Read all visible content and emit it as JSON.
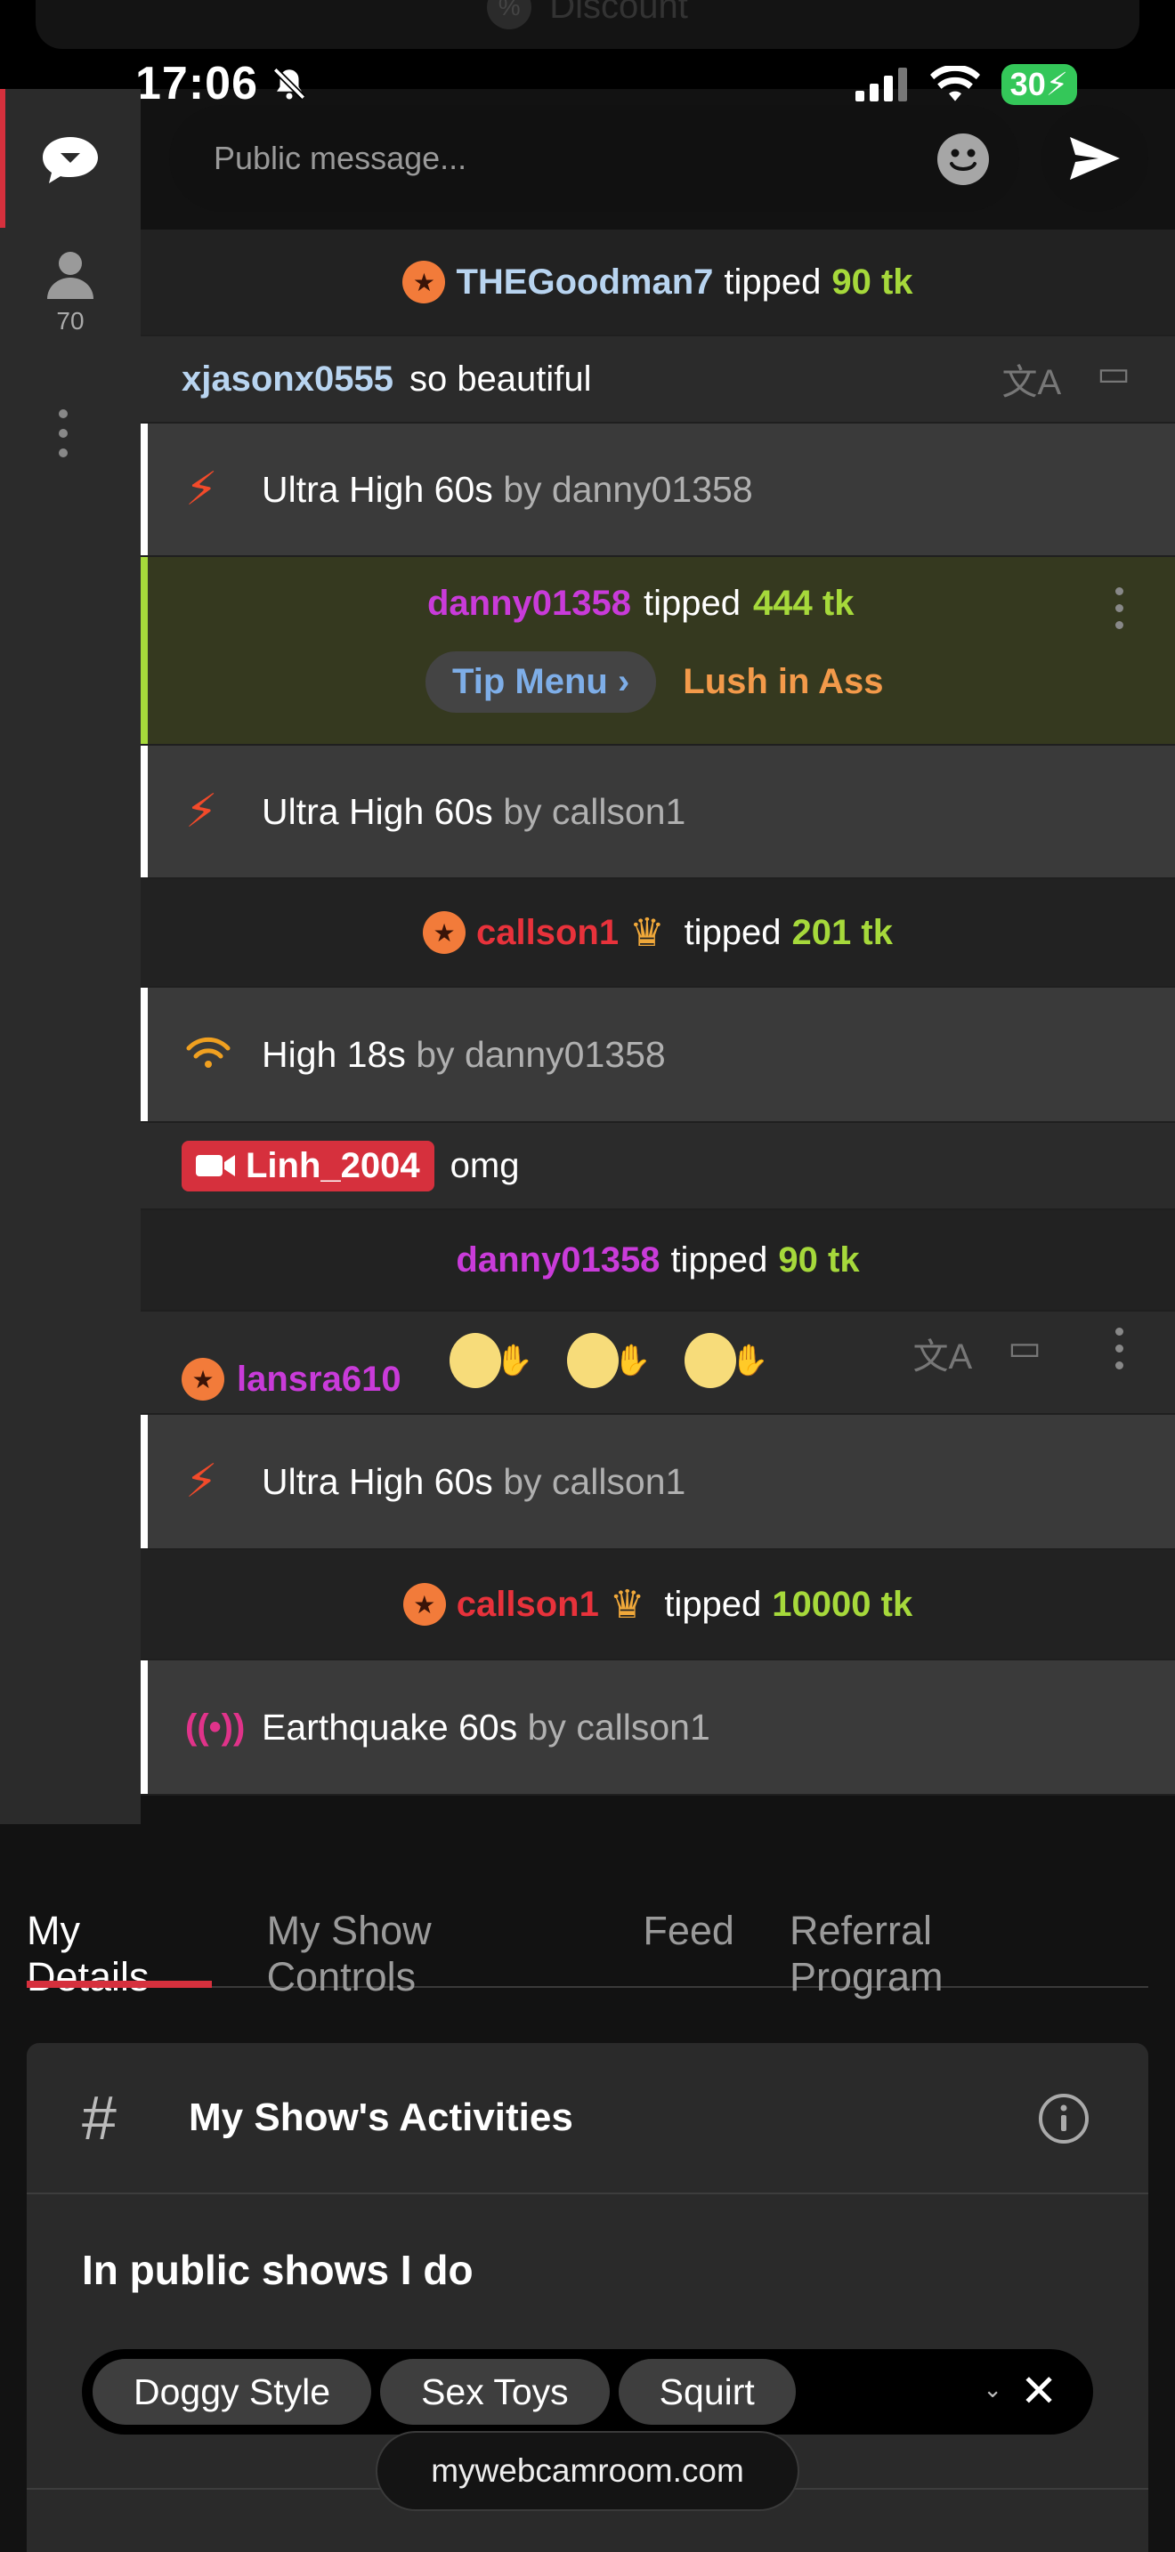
{
  "status_bar": {
    "time": "17:06",
    "battery": "30"
  },
  "ghost_banner": {
    "label": "Discount",
    "icon": "percent-icon"
  },
  "side_rail": {
    "users_count": "70"
  },
  "composer": {
    "placeholder": "Public message..."
  },
  "chat": {
    "r1": {
      "user": "THEGoodman7",
      "verb": "tipped",
      "amount": "90 tk"
    },
    "r2": {
      "user": "xjasonx0555",
      "text": "so beautiful"
    },
    "r3": {
      "level": "Ultra High 60s",
      "by": "by",
      "user": "danny01358"
    },
    "r4": {
      "user": "danny01358",
      "verb": "tipped",
      "amount": "444 tk",
      "chip": "Tip Menu",
      "item": "Lush in Ass"
    },
    "r5": {
      "level": "Ultra High 60s",
      "by": "by",
      "user": "callson1"
    },
    "r6": {
      "user": "callson1",
      "verb": "tipped",
      "amount": "201 tk"
    },
    "r7": {
      "level": "High 18s",
      "by": "by",
      "user": "danny01358"
    },
    "r8": {
      "user": "Linh_2004",
      "text": "omg"
    },
    "r9": {
      "user": "danny01358",
      "verb": "tipped",
      "amount": "90 tk"
    },
    "r10": {
      "user": "lansra610"
    },
    "r11": {
      "level": "Ultra High 60s",
      "by": "by",
      "user": "callson1"
    },
    "r12": {
      "user": "callson1",
      "verb": "tipped",
      "amount": "10000 tk"
    },
    "r13": {
      "level": "Earthquake 60s",
      "by": "by",
      "user": "callson1"
    }
  },
  "tabs": [
    "My Details",
    "My Show Controls",
    "Feed",
    "Referral Program"
  ],
  "card": {
    "title": "My Show's Activities",
    "subtitle": "In public shows I do",
    "tags": [
      "Doggy Style",
      "Sex Toys",
      "Squirt"
    ]
  },
  "url": "mywebcamroom.com",
  "colors": {
    "accent": "#d6303d",
    "tip": "#a6d93b",
    "purple_user": "#c93bd9",
    "red_user": "#e8323b",
    "blue_user": "#b8d4f0"
  }
}
